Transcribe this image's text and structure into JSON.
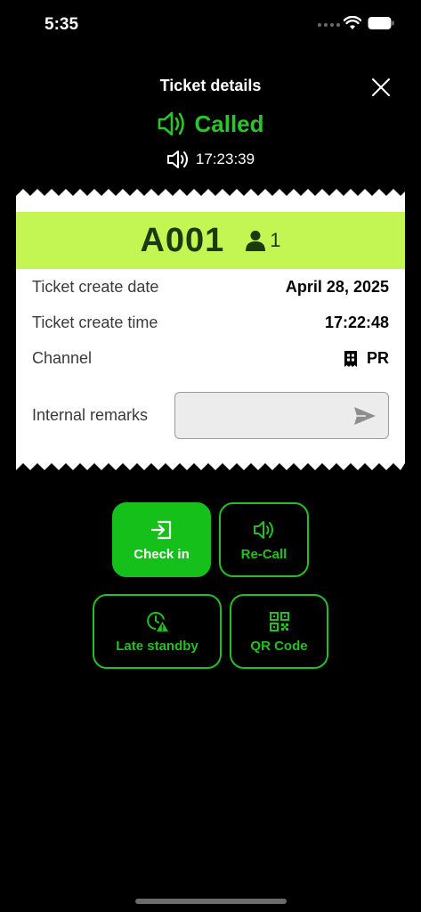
{
  "status_bar": {
    "time": "5:35"
  },
  "header": {
    "title": "Ticket details"
  },
  "call_status": {
    "label": "Called",
    "time": "17:23:39"
  },
  "ticket": {
    "number": "A001",
    "party_count": "1",
    "rows": {
      "create_date": {
        "label": "Ticket create date",
        "value": "April 28, 2025"
      },
      "create_time": {
        "label": "Ticket create time",
        "value": "17:22:48"
      },
      "channel": {
        "label": "Channel",
        "value": "PR"
      }
    },
    "remarks": {
      "label": "Internal remarks",
      "value": "",
      "placeholder": ""
    }
  },
  "actions": {
    "check_in": "Check in",
    "recall": "Re-Call",
    "late_standby": "Late standby",
    "qr_code": "QR Code"
  },
  "colors": {
    "accent_green": "#22c022",
    "banner_green": "#c3f653",
    "background": "#000000"
  },
  "icons": [
    "wifi-icon",
    "battery-icon",
    "close-icon",
    "speaker-icon",
    "person-icon",
    "ticket-channel-icon",
    "send-icon",
    "check-in-icon",
    "clock-alert-icon",
    "qr-code-icon"
  ]
}
